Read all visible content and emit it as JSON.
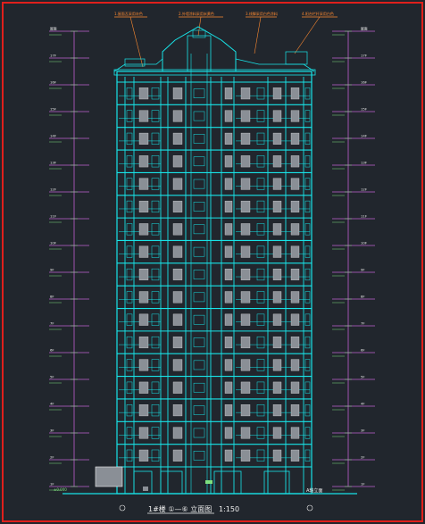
{
  "drawing": {
    "title": "1#楼 ①—⑥ 立面图",
    "scale": "1:150",
    "bottom_left_label": "±0.000",
    "bottom_right_label": "A轴立面",
    "top_callouts": [
      "1.屋面瓦采用灰色",
      "2.外墙涂料采用米黄色",
      "3.线脚采用白色涂料",
      "4.阳台栏杆采用白色"
    ],
    "level_labels": [
      "屋面",
      "17F",
      "16F",
      "15F",
      "14F",
      "13F",
      "12F",
      "11F",
      "10F",
      "9F",
      "8F",
      "7F",
      "6F",
      "5F",
      "4F",
      "3F",
      "2F",
      "1F"
    ],
    "colors": {
      "background": "#21262d",
      "border": "#e0201c",
      "facade": "#18e4e8",
      "level_line": "#c060d0",
      "text_green": "#7ee07e",
      "text_white": "#f0f0f0",
      "callout": "#ff8a30",
      "window_fill": "#8a8f96"
    }
  }
}
